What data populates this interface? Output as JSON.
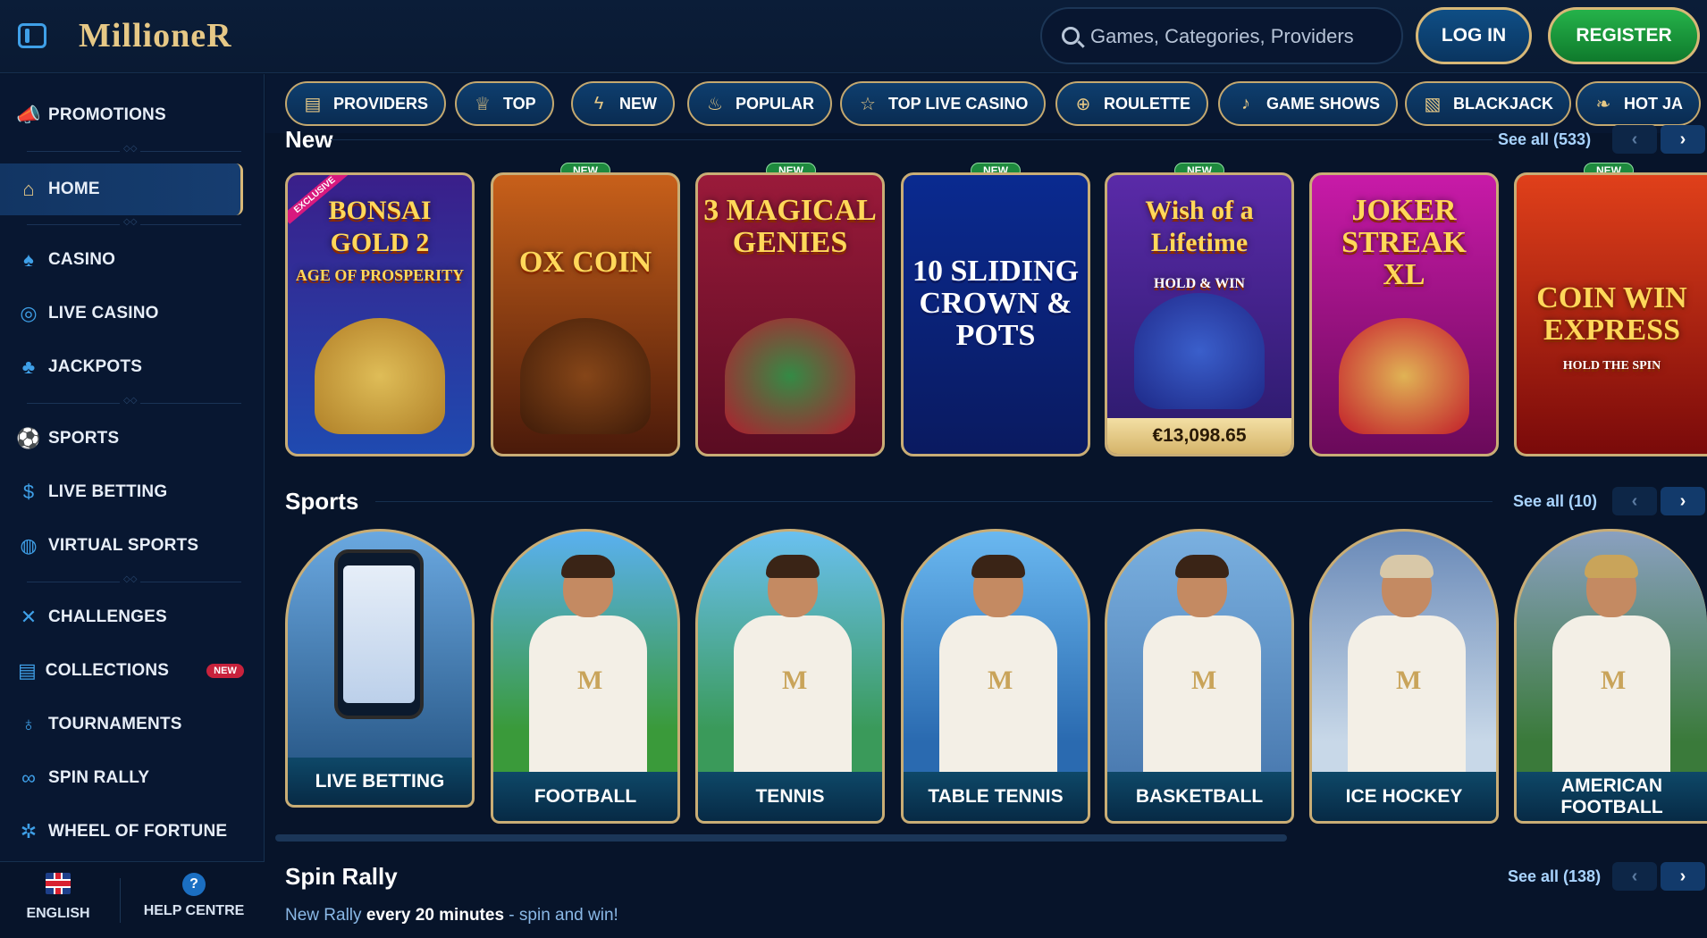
{
  "header": {
    "logo": "MillioneR",
    "search_placeholder": "Games, Categories, Providers",
    "login": "LOG IN",
    "register": "REGISTER"
  },
  "sidebar": {
    "items": [
      {
        "label": "PROMOTIONS",
        "icon": "megaphone-icon"
      },
      {
        "label": "HOME",
        "icon": "home-icon"
      },
      {
        "label": "CASINO",
        "icon": "spade-icon"
      },
      {
        "label": "LIVE CASINO",
        "icon": "chip-icon"
      },
      {
        "label": "JACKPOTS",
        "icon": "clover-icon"
      },
      {
        "label": "SPORTS",
        "icon": "soccer-ball-icon"
      },
      {
        "label": "LIVE BETTING",
        "icon": "coin-icon"
      },
      {
        "label": "VIRTUAL SPORTS",
        "icon": "globe-icon"
      },
      {
        "label": "CHALLENGES",
        "icon": "swords-icon"
      },
      {
        "label": "COLLECTIONS",
        "icon": "cards-icon",
        "badge": "NEW"
      },
      {
        "label": "TOURNAMENTS",
        "icon": "medal-icon"
      },
      {
        "label": "SPIN RALLY",
        "icon": "rally-icon"
      },
      {
        "label": "WHEEL OF FORTUNE",
        "icon": "wheel-icon"
      }
    ],
    "footer": {
      "language": "ENGLISH",
      "help": "HELP CENTRE"
    }
  },
  "categories": [
    {
      "label": "PROVIDERS",
      "icon": "list-icon"
    },
    {
      "label": "TOP",
      "icon": "crown-icon"
    },
    {
      "label": "NEW",
      "icon": "lightning-icon"
    },
    {
      "label": "POPULAR",
      "icon": "fire-icon"
    },
    {
      "label": "TOP LIVE CASINO",
      "icon": "star-icon"
    },
    {
      "label": "ROULETTE",
      "icon": "roulette-icon"
    },
    {
      "label": "GAME SHOWS",
      "icon": "microphone-icon"
    },
    {
      "label": "BLACKJACK",
      "icon": "cards-icon"
    },
    {
      "label": "HOT JA",
      "icon": "chili-icon"
    }
  ],
  "new_section": {
    "title": "New",
    "see_all": "See all (533)",
    "games": [
      {
        "title": "BONSAI GOLD 2",
        "sub": "AGE OF PROSPERITY",
        "tag": "EXCLUSIVE",
        "bg": "#3a1f8a"
      },
      {
        "title": "OX COIN",
        "sub": "",
        "tag": "NEW",
        "bg": "#6b2a14"
      },
      {
        "title": "3 MAGICAL GENIES",
        "sub": "",
        "tag": "NEW",
        "bg": "#7a1636"
      },
      {
        "title": "10 SLIDING CROWN & POTS",
        "sub": "",
        "tag": "NEW",
        "bg": "#0c2e9c"
      },
      {
        "title": "Wish of a Lifetime",
        "sub": "HOLD & WIN",
        "tag": "NEW",
        "bg": "#4a2a9a",
        "jackpot": "€13,098.65"
      },
      {
        "title": "JOKER STREAK XL",
        "sub": "",
        "tag": "",
        "bg": "#a01a8a"
      },
      {
        "title": "COIN WIN EXPRESS",
        "sub": "HOLD THE SPIN",
        "tag": "NEW",
        "bg": "#b0200f"
      }
    ]
  },
  "sports_section": {
    "title": "Sports",
    "see_all": "See all (10)",
    "cards": [
      {
        "label": "LIVE BETTING",
        "bg": "#4a7fb0"
      },
      {
        "label": "FOOTBALL",
        "bg": "#3f8fd8"
      },
      {
        "label": "TENNIS",
        "bg": "#4aa0c8"
      },
      {
        "label": "TABLE TENNIS",
        "bg": "#4a9cd0"
      },
      {
        "label": "BASKETBALL",
        "bg": "#5a92c2"
      },
      {
        "label": "ICE HOCKEY",
        "bg": "#5a7ea8"
      },
      {
        "label": "AMERICAN FOOTBALL",
        "bg": "#6a8ab0"
      }
    ]
  },
  "spin_rally": {
    "title": "Spin Rally",
    "see_all": "See all (138)",
    "sub_prefix": "New Rally ",
    "sub_bold": "every 20 minutes",
    "sub_suffix": " - spin and win!"
  },
  "colors": {
    "accent_gold": "#c9ad75",
    "accent_blue": "#3fa0e8",
    "register_green": "#1f9a3e"
  }
}
